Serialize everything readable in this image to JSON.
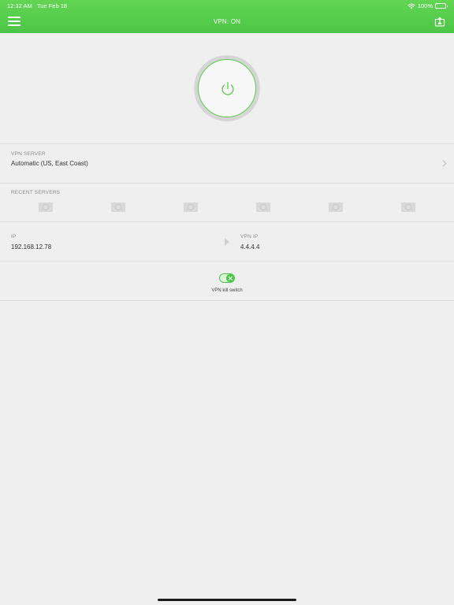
{
  "status_bar": {
    "time": "12:32 AM",
    "date": "Tue Feb 18",
    "battery": "100%"
  },
  "nav": {
    "title": "VPN: ON",
    "menu_icon": "hamburger-menu-icon",
    "share_icon": "share-icon"
  },
  "power": {
    "icon": "power-icon",
    "state": "on"
  },
  "vpn_server": {
    "label": "VPN SERVER",
    "value": "Automatic (US, East Coast)"
  },
  "recent_servers": {
    "label": "RECENT SERVERS",
    "count": 6
  },
  "ip": {
    "label": "IP",
    "value": "192.168.12.78"
  },
  "vpn_ip": {
    "label": "VPN IP",
    "value": "4.4.4.4"
  },
  "kill_switch": {
    "label": "VPN kill switch",
    "enabled": true
  },
  "colors": {
    "accent": "#4cc546",
    "background": "#efefef",
    "divider": "#dcdcdc"
  }
}
